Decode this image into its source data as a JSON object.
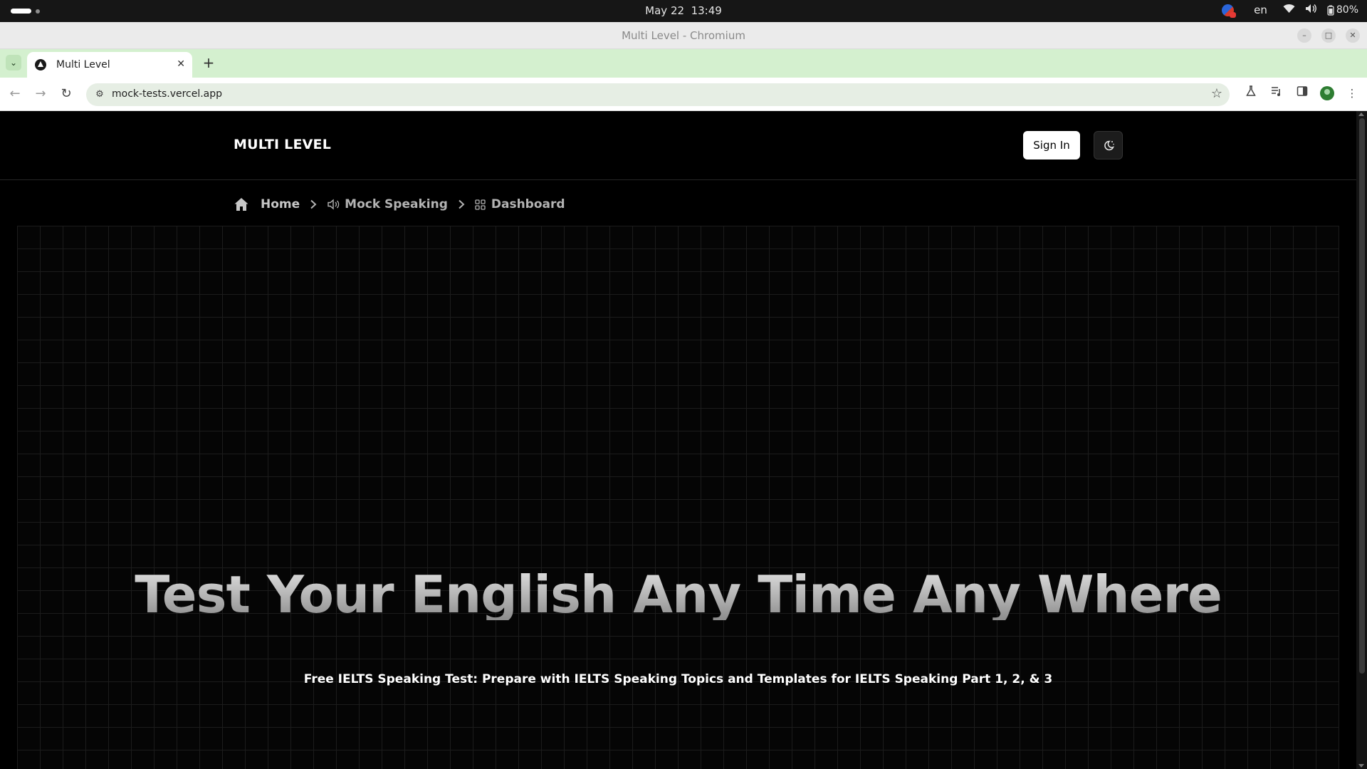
{
  "os": {
    "date": "May 22",
    "time": "13:49",
    "language": "en",
    "battery": "80%"
  },
  "window": {
    "title": "Multi Level - Chromium"
  },
  "tabs": [
    {
      "label": "Multi Level",
      "active": true
    }
  ],
  "omnibox": {
    "url": "mock-tests.vercel.app"
  },
  "site": {
    "logo": "MULTI LEVEL",
    "signin_label": "Sign In"
  },
  "breadcrumb": {
    "home": "Home",
    "mock_speaking": "Mock Speaking",
    "dashboard": "Dashboard"
  },
  "hero": {
    "title": "Test Your English Any Time Any Where",
    "subtitle": "Free IELTS Speaking Test: Prepare with IELTS Speaking Topics and Templates for IELTS Speaking Part 1, 2, & 3"
  },
  "colors": {
    "tabstrip": "#d4f0cf",
    "page_bg": "#000000",
    "grid_line": "#1c1c1c"
  }
}
